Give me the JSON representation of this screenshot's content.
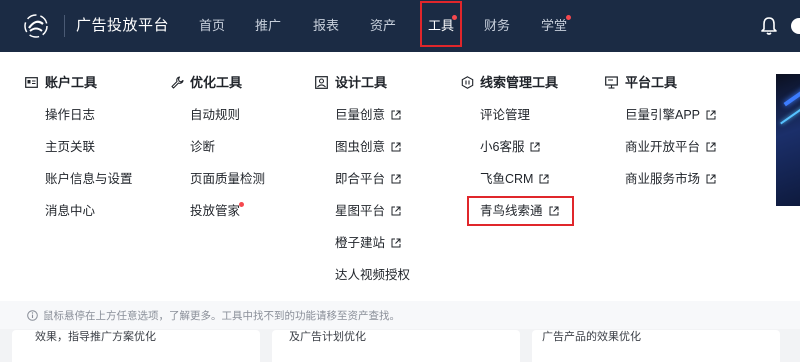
{
  "topbar": {
    "brand": "广告投放平台",
    "nav": [
      {
        "label": "首页"
      },
      {
        "label": "推广"
      },
      {
        "label": "报表"
      },
      {
        "label": "资产"
      },
      {
        "label": "工具"
      },
      {
        "label": "财务"
      },
      {
        "label": "学堂"
      }
    ]
  },
  "columns": [
    {
      "title": "账户工具",
      "icon": "account-card-icon",
      "links": [
        {
          "label": "操作日志"
        },
        {
          "label": "主页关联"
        },
        {
          "label": "账户信息与设置"
        },
        {
          "label": "消息中心"
        }
      ]
    },
    {
      "title": "优化工具",
      "icon": "wrench-icon",
      "links": [
        {
          "label": "自动规则"
        },
        {
          "label": "诊断"
        },
        {
          "label": "页面质量检测"
        },
        {
          "label": "投放管家"
        }
      ]
    },
    {
      "title": "设计工具",
      "icon": "image-frame-icon",
      "links": [
        {
          "label": "巨量创意"
        },
        {
          "label": "图虫创意"
        },
        {
          "label": "即合平台"
        },
        {
          "label": "星图平台"
        },
        {
          "label": "橙子建站"
        },
        {
          "label": "达人视频授权"
        }
      ]
    },
    {
      "title": "线索管理工具",
      "icon": "leads-hex-icon",
      "links": [
        {
          "label": "评论管理"
        },
        {
          "label": "小6客服"
        },
        {
          "label": "飞鱼CRM"
        },
        {
          "label": "青鸟线索通"
        }
      ]
    },
    {
      "title": "平台工具",
      "icon": "monitor-icon",
      "links": [
        {
          "label": "巨量引擎APP"
        },
        {
          "label": "商业开放平台"
        },
        {
          "label": "商业服务市场"
        }
      ]
    }
  ],
  "hint": "鼠标悬停在上方任意选项，了解更多。工具中找不到的功能请移至资产查找。",
  "cards": [
    {
      "text": "效果，指导推广方案优化"
    },
    {
      "text": "及广告计划优化"
    },
    {
      "text": "广告产品的效果优化"
    }
  ],
  "colors": {
    "nav_bg": "#1b2b44",
    "highlight_red": "#e0262b",
    "badge_red": "#f5484e"
  }
}
